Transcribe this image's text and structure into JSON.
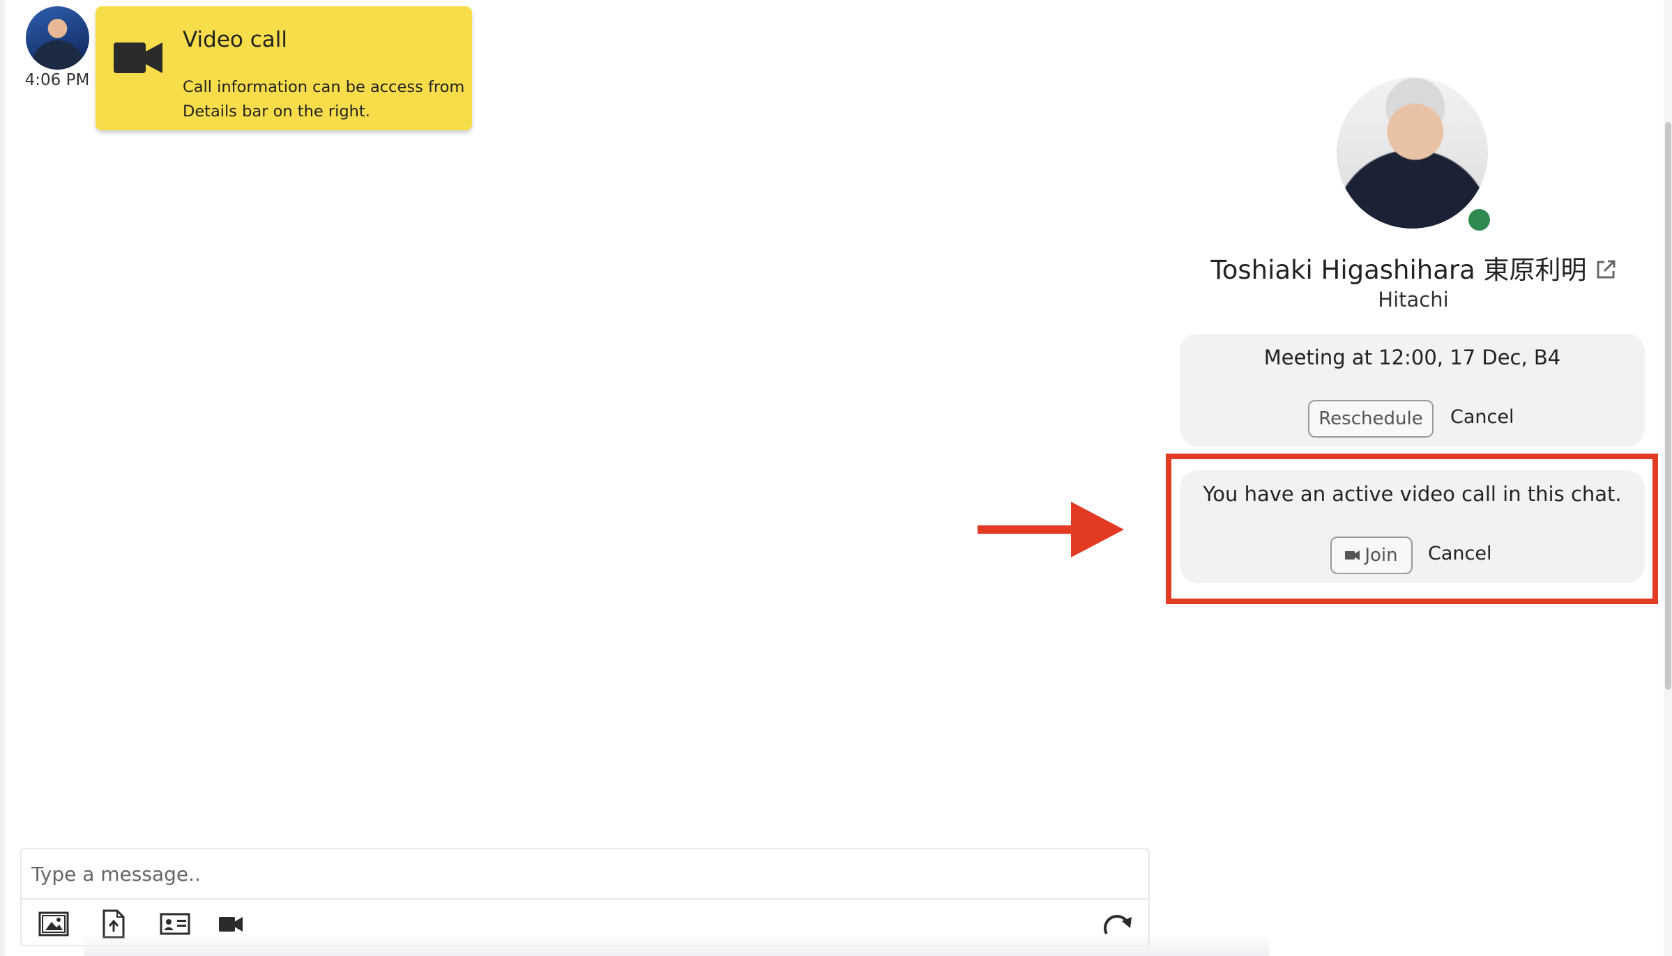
{
  "message": {
    "time": "4:06 PM",
    "title": "Video call",
    "body": "Call information can be access from Details bar on the right."
  },
  "composer": {
    "placeholder": "Type a message.."
  },
  "contact": {
    "name": "Toshiaki Higashihara 東原利明",
    "company": "Hitachi",
    "status": "online"
  },
  "meeting_card": {
    "text": "Meeting at 12:00, 17 Dec, B4",
    "reschedule_label": "Reschedule",
    "cancel_label": "Cancel"
  },
  "call_card": {
    "text": "You have an active video call in this chat.",
    "join_label": "Join",
    "cancel_label": "Cancel"
  },
  "colors": {
    "bubble": "#f8dd4b",
    "highlight": "#e23a23",
    "online": "#2f8a52"
  }
}
